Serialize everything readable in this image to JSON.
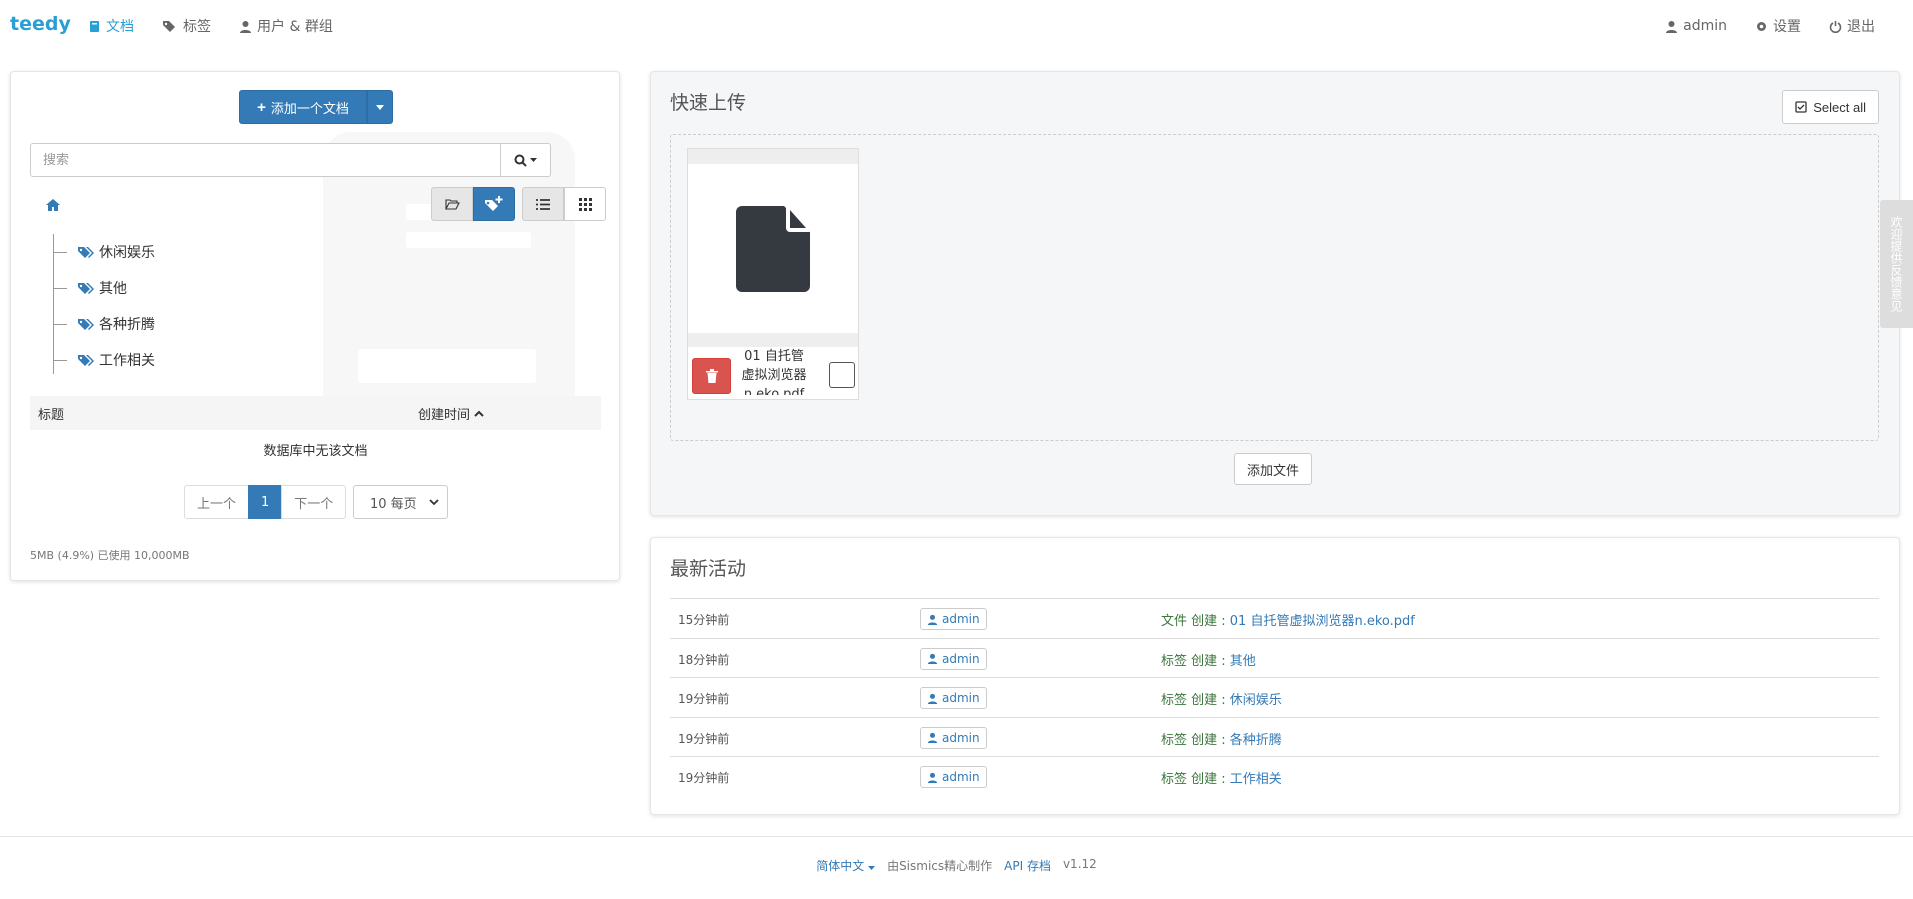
{
  "nav": {
    "brand": "teedy",
    "documents": "文档",
    "tags": "标签",
    "users_groups": "用户 & 群组",
    "user": "admin",
    "settings": "设置",
    "logout": "退出"
  },
  "left": {
    "add_document": "添加一个文档",
    "search_placeholder": "搜索",
    "tags": [
      "休闲娱乐",
      "其他",
      "各种折腾",
      "工作相关"
    ],
    "table": {
      "col_title": "标题",
      "col_created": "创建时间"
    },
    "empty_message": "数据库中无该文档",
    "pagination": {
      "prev": "上一个",
      "current": "1",
      "next": "下一个"
    },
    "per_page": "10 每页",
    "quota": "5MB (4.9%) 已使用 10,000MB"
  },
  "upload": {
    "title": "快速上传",
    "select_all": "Select all",
    "file_name": "01 自托管虚拟浏览器n.eko.pdf",
    "add_file": "添加文件"
  },
  "activity": {
    "title": "最新活动",
    "rows": [
      {
        "time": "15分钟前",
        "user": "admin",
        "action": "文件 创建 : ",
        "target": "01 自托管虚拟浏览器n.eko.pdf"
      },
      {
        "time": "18分钟前",
        "user": "admin",
        "action": "标签 创建 : ",
        "target": "其他"
      },
      {
        "time": "19分钟前",
        "user": "admin",
        "action": "标签 创建 : ",
        "target": "休闲娱乐"
      },
      {
        "time": "19分钟前",
        "user": "admin",
        "action": "标签 创建 : ",
        "target": "各种折腾"
      },
      {
        "time": "19分钟前",
        "user": "admin",
        "action": "标签 创建 : ",
        "target": "工作相关"
      }
    ]
  },
  "feedback": "欢迎提供反馈意见",
  "footer": {
    "language": "简体中文",
    "made_by": "由Sismics精心制作",
    "api_docs": "API 存档",
    "version": "v1.12"
  },
  "colors": {
    "brand": "#2a9fd6",
    "primary": "#337ab7",
    "danger": "#d9534f",
    "success_text": "#3c763d"
  }
}
